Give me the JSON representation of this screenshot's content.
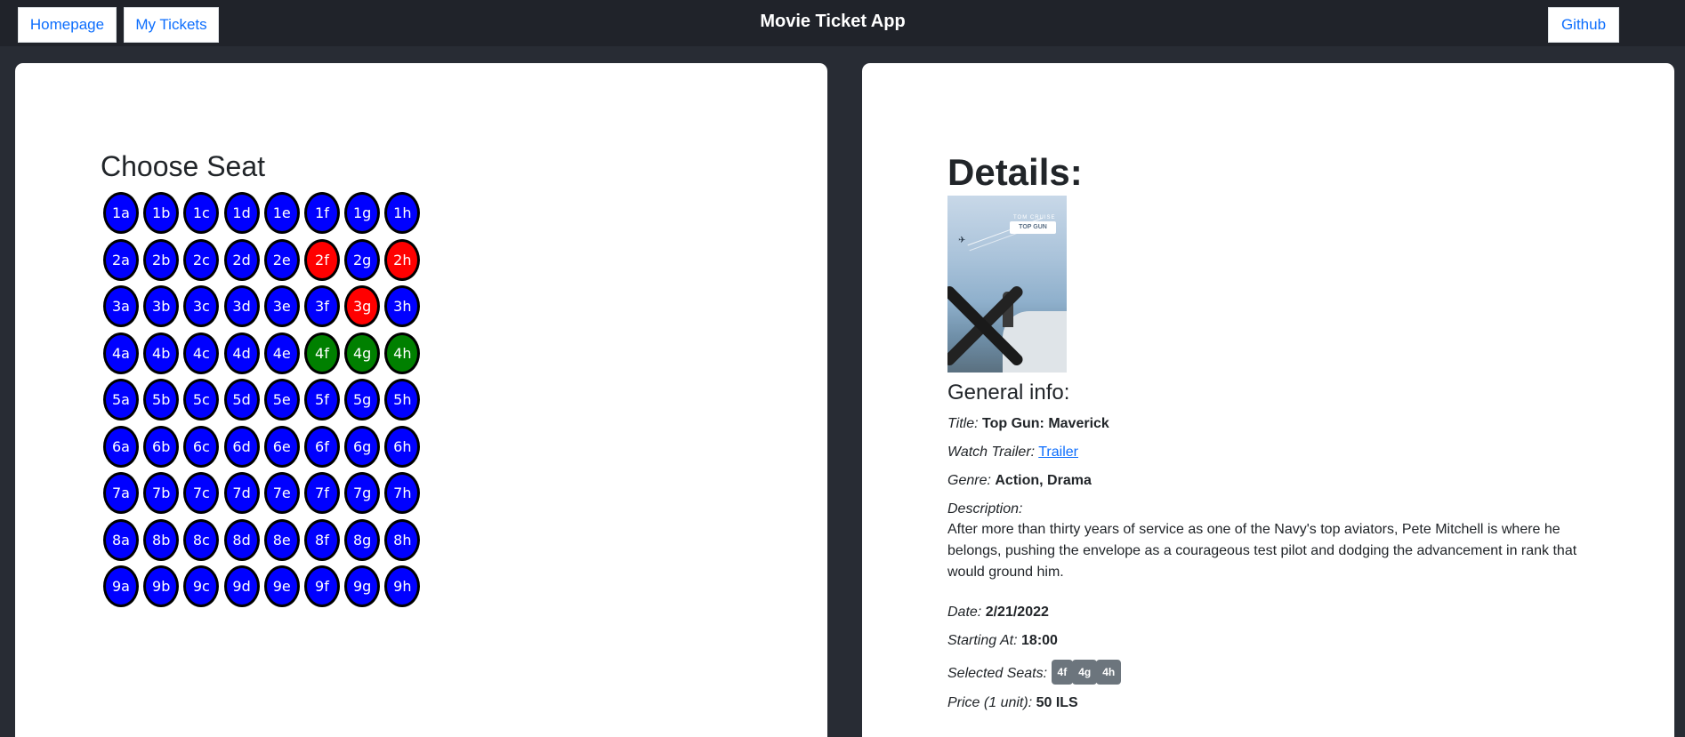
{
  "nav": {
    "homepage": "Homepage",
    "my_tickets": "My Tickets",
    "title": "Movie Ticket App",
    "github": "Github"
  },
  "seats": {
    "title": "Choose Seat",
    "rows": [
      [
        "1a",
        "1b",
        "1c",
        "1d",
        "1e",
        "1f",
        "1g",
        "1h"
      ],
      [
        "2a",
        "2b",
        "2c",
        "2d",
        "2e",
        "2f",
        "2g",
        "2h"
      ],
      [
        "3a",
        "3b",
        "3c",
        "3d",
        "3e",
        "3f",
        "3g",
        "3h"
      ],
      [
        "4a",
        "4b",
        "4c",
        "4d",
        "4e",
        "4f",
        "4g",
        "4h"
      ],
      [
        "5a",
        "5b",
        "5c",
        "5d",
        "5e",
        "5f",
        "5g",
        "5h"
      ],
      [
        "6a",
        "6b",
        "6c",
        "6d",
        "6e",
        "6f",
        "6g",
        "6h"
      ],
      [
        "7a",
        "7b",
        "7c",
        "7d",
        "7e",
        "7f",
        "7g",
        "7h"
      ],
      [
        "8a",
        "8b",
        "8c",
        "8d",
        "8e",
        "8f",
        "8g",
        "8h"
      ],
      [
        "9a",
        "9b",
        "9c",
        "9d",
        "9e",
        "9f",
        "9g",
        "9h"
      ]
    ],
    "taken": [
      "2f",
      "2h",
      "3g"
    ],
    "selected": [
      "4f",
      "4g",
      "4h"
    ],
    "colors": {
      "available": "#0000ff",
      "taken": "#ff0000",
      "selected": "#008000"
    }
  },
  "details": {
    "title": "Details:",
    "poster": {
      "name_text": "TOM CRUISE",
      "logo_text": "TOP GUN",
      "icon": "jet-icon"
    },
    "general_title": "General info:",
    "title_label": "Title:",
    "title_value": "Top Gun: Maverick",
    "trailer_label": "Watch Trailer:",
    "trailer_link": "Trailer",
    "genre_label": "Genre:",
    "genre_value": "Action, Drama",
    "description_label": "Description:",
    "description_value": "After more than thirty years of service as one of the Navy's top aviators, Pete Mitchell is where he belongs, pushing the envelope as a courageous test pilot and dodging the advancement in rank that would ground him.",
    "date_label": "Date:",
    "date_value": "2/21/2022",
    "start_label": "Starting At:",
    "start_value": "18:00",
    "seats_label": "Selected Seats:",
    "selected_seats": [
      "4f",
      "4g",
      "4h"
    ],
    "price_label": "Price (1 unit):",
    "price_value": "50 ILS"
  }
}
